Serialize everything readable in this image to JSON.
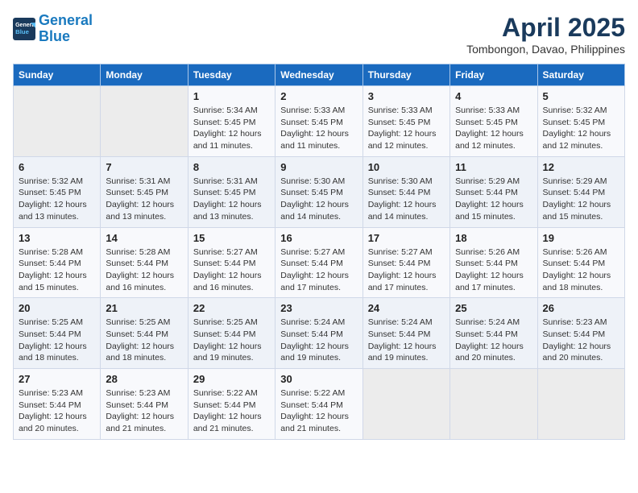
{
  "header": {
    "logo_line1": "General",
    "logo_line2": "Blue",
    "title": "April 2025",
    "subtitle": "Tombongon, Davao, Philippines"
  },
  "columns": [
    "Sunday",
    "Monday",
    "Tuesday",
    "Wednesday",
    "Thursday",
    "Friday",
    "Saturday"
  ],
  "weeks": [
    [
      {
        "day": "",
        "info": ""
      },
      {
        "day": "",
        "info": ""
      },
      {
        "day": "1",
        "info": "Sunrise: 5:34 AM\nSunset: 5:45 PM\nDaylight: 12 hours and 11 minutes."
      },
      {
        "day": "2",
        "info": "Sunrise: 5:33 AM\nSunset: 5:45 PM\nDaylight: 12 hours and 11 minutes."
      },
      {
        "day": "3",
        "info": "Sunrise: 5:33 AM\nSunset: 5:45 PM\nDaylight: 12 hours and 12 minutes."
      },
      {
        "day": "4",
        "info": "Sunrise: 5:33 AM\nSunset: 5:45 PM\nDaylight: 12 hours and 12 minutes."
      },
      {
        "day": "5",
        "info": "Sunrise: 5:32 AM\nSunset: 5:45 PM\nDaylight: 12 hours and 12 minutes."
      }
    ],
    [
      {
        "day": "6",
        "info": "Sunrise: 5:32 AM\nSunset: 5:45 PM\nDaylight: 12 hours and 13 minutes."
      },
      {
        "day": "7",
        "info": "Sunrise: 5:31 AM\nSunset: 5:45 PM\nDaylight: 12 hours and 13 minutes."
      },
      {
        "day": "8",
        "info": "Sunrise: 5:31 AM\nSunset: 5:45 PM\nDaylight: 12 hours and 13 minutes."
      },
      {
        "day": "9",
        "info": "Sunrise: 5:30 AM\nSunset: 5:45 PM\nDaylight: 12 hours and 14 minutes."
      },
      {
        "day": "10",
        "info": "Sunrise: 5:30 AM\nSunset: 5:44 PM\nDaylight: 12 hours and 14 minutes."
      },
      {
        "day": "11",
        "info": "Sunrise: 5:29 AM\nSunset: 5:44 PM\nDaylight: 12 hours and 15 minutes."
      },
      {
        "day": "12",
        "info": "Sunrise: 5:29 AM\nSunset: 5:44 PM\nDaylight: 12 hours and 15 minutes."
      }
    ],
    [
      {
        "day": "13",
        "info": "Sunrise: 5:28 AM\nSunset: 5:44 PM\nDaylight: 12 hours and 15 minutes."
      },
      {
        "day": "14",
        "info": "Sunrise: 5:28 AM\nSunset: 5:44 PM\nDaylight: 12 hours and 16 minutes."
      },
      {
        "day": "15",
        "info": "Sunrise: 5:27 AM\nSunset: 5:44 PM\nDaylight: 12 hours and 16 minutes."
      },
      {
        "day": "16",
        "info": "Sunrise: 5:27 AM\nSunset: 5:44 PM\nDaylight: 12 hours and 17 minutes."
      },
      {
        "day": "17",
        "info": "Sunrise: 5:27 AM\nSunset: 5:44 PM\nDaylight: 12 hours and 17 minutes."
      },
      {
        "day": "18",
        "info": "Sunrise: 5:26 AM\nSunset: 5:44 PM\nDaylight: 12 hours and 17 minutes."
      },
      {
        "day": "19",
        "info": "Sunrise: 5:26 AM\nSunset: 5:44 PM\nDaylight: 12 hours and 18 minutes."
      }
    ],
    [
      {
        "day": "20",
        "info": "Sunrise: 5:25 AM\nSunset: 5:44 PM\nDaylight: 12 hours and 18 minutes."
      },
      {
        "day": "21",
        "info": "Sunrise: 5:25 AM\nSunset: 5:44 PM\nDaylight: 12 hours and 18 minutes."
      },
      {
        "day": "22",
        "info": "Sunrise: 5:25 AM\nSunset: 5:44 PM\nDaylight: 12 hours and 19 minutes."
      },
      {
        "day": "23",
        "info": "Sunrise: 5:24 AM\nSunset: 5:44 PM\nDaylight: 12 hours and 19 minutes."
      },
      {
        "day": "24",
        "info": "Sunrise: 5:24 AM\nSunset: 5:44 PM\nDaylight: 12 hours and 19 minutes."
      },
      {
        "day": "25",
        "info": "Sunrise: 5:24 AM\nSunset: 5:44 PM\nDaylight: 12 hours and 20 minutes."
      },
      {
        "day": "26",
        "info": "Sunrise: 5:23 AM\nSunset: 5:44 PM\nDaylight: 12 hours and 20 minutes."
      }
    ],
    [
      {
        "day": "27",
        "info": "Sunrise: 5:23 AM\nSunset: 5:44 PM\nDaylight: 12 hours and 20 minutes."
      },
      {
        "day": "28",
        "info": "Sunrise: 5:23 AM\nSunset: 5:44 PM\nDaylight: 12 hours and 21 minutes."
      },
      {
        "day": "29",
        "info": "Sunrise: 5:22 AM\nSunset: 5:44 PM\nDaylight: 12 hours and 21 minutes."
      },
      {
        "day": "30",
        "info": "Sunrise: 5:22 AM\nSunset: 5:44 PM\nDaylight: 12 hours and 21 minutes."
      },
      {
        "day": "",
        "info": ""
      },
      {
        "day": "",
        "info": ""
      },
      {
        "day": "",
        "info": ""
      }
    ]
  ]
}
